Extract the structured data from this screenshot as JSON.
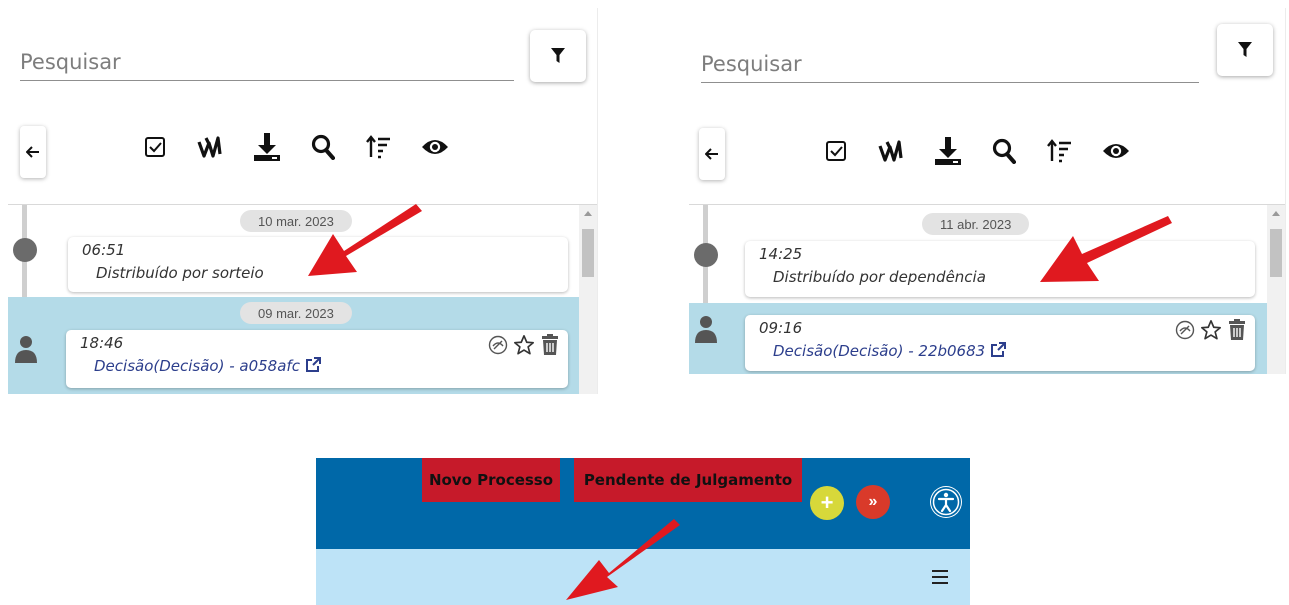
{
  "panels": [
    {
      "search_placeholder": "Pesquisar",
      "events": [
        {
          "date": "10 mar. 2023",
          "time": "06:51",
          "description": "Distribuído por sorteio"
        },
        {
          "date": "09 mar. 2023",
          "time": "18:46",
          "description": "Decisão(Decisão) - a058afc"
        }
      ]
    },
    {
      "search_placeholder": "Pesquisar",
      "events": [
        {
          "date": "11 abr. 2023",
          "time": "14:25",
          "description": "Distribuído por dependência"
        },
        {
          "time": "09:16",
          "description": "Decisão(Decisão) - 22b0683"
        }
      ]
    }
  ],
  "toolbar_icons": [
    "checkbox-icon",
    "signature-icon",
    "download-icon",
    "search-icon",
    "sort-icon",
    "eye-icon"
  ],
  "header": {
    "tags": [
      "Novo Processo",
      "Pendente de Julgamento"
    ],
    "add_button": "+",
    "forward_button": "»"
  },
  "colors": {
    "header_blue": "#0068a8",
    "header_light": "#bde3f7",
    "tag_red": "#c61a2a",
    "highlight": "#b4dbe8",
    "arrow_red": "#e0191f",
    "link_blue": "#2c3e8c"
  }
}
